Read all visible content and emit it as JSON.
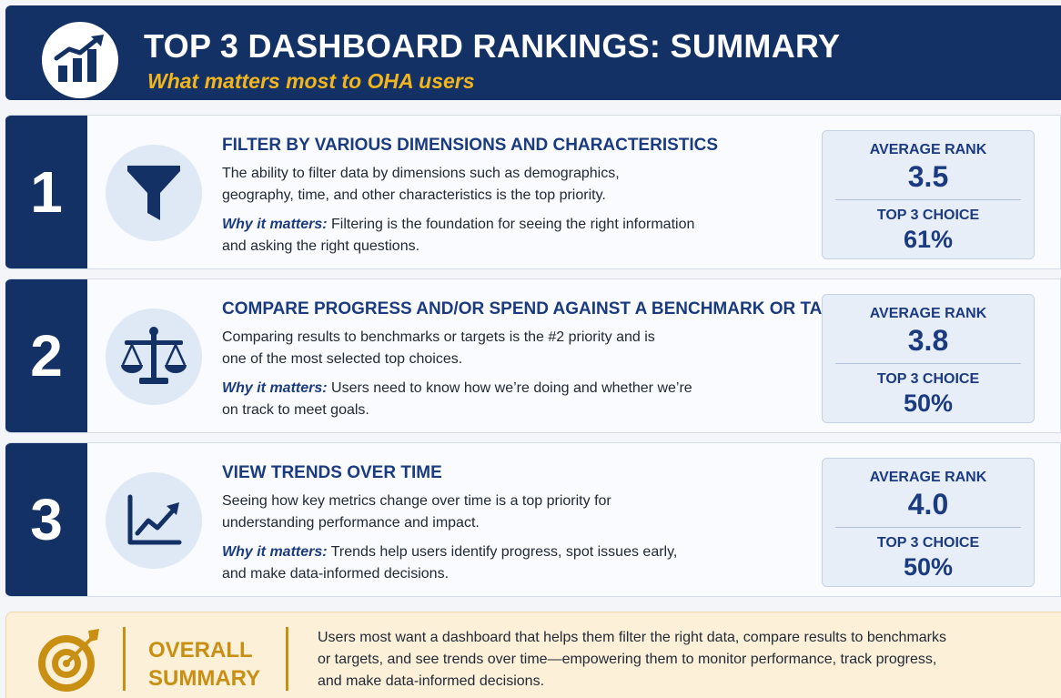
{
  "header": {
    "title": "TOP 3 DASHBOARD RANKINGS: SUMMARY",
    "subtitle": "What matters most to OHA users",
    "icon": "growth-chart-icon"
  },
  "colors": {
    "navy": "#143166",
    "accent_blue": "#1b3b80",
    "gold": "#f2b51c",
    "summary_gold": "#c98f12",
    "summary_background": "#fcf0d9"
  },
  "rankings": [
    {
      "rank": "1",
      "icon": "funnel-icon",
      "heading": "FILTER BY VARIOUS DIMENSIONS AND CHARACTERISTICS",
      "description": "The ability to filter data by dimensions such as demographics, geography, time, and other characteristics is the top priority.",
      "why_label": "Why it matters:",
      "why_text": " Filtering is the foundation for seeing the right information and asking the right questions.",
      "avg_rank_label": "AVERAGE RANK",
      "avg_rank": "3.5",
      "top3_label": "TOP 3 CHOICE",
      "top3": "61%"
    },
    {
      "rank": "2",
      "icon": "scale-icon",
      "heading": "COMPARE PROGRESS AND/OR SPEND AGAINST A BENCHMARK OR TARGET",
      "description": "Comparing results to benchmarks or targets is the #2 priority and is one of the most selected top choices.",
      "why_label": "Why it matters:",
      "why_text": " Users need to know how we’re doing and whether we’re on track to meet goals.",
      "avg_rank_label": "AVERAGE RANK",
      "avg_rank": "3.8",
      "top3_label": "TOP 3 CHOICE",
      "top3": "50%"
    },
    {
      "rank": "3",
      "icon": "trend-chart-icon",
      "heading": "VIEW TRENDS OVER TIME",
      "description": "Seeing how key metrics change over time is a top priority for understanding performance and impact.",
      "why_label": "Why it matters:",
      "why_text": " Trends help users identify progress, spot issues early, and make data-informed decisions.",
      "avg_rank_label": "AVERAGE RANK",
      "avg_rank": "4.0",
      "top3_label": "TOP 3 CHOICE",
      "top3": "50%"
    }
  ],
  "summary": {
    "icon": "target-icon",
    "title": "OVERALL SUMMARY",
    "text": "Users most want a dashboard that helps them filter the right data, compare results to benchmarks or targets, and see trends over time—empowering them to monitor performance, track progress, and make data-informed decisions."
  }
}
